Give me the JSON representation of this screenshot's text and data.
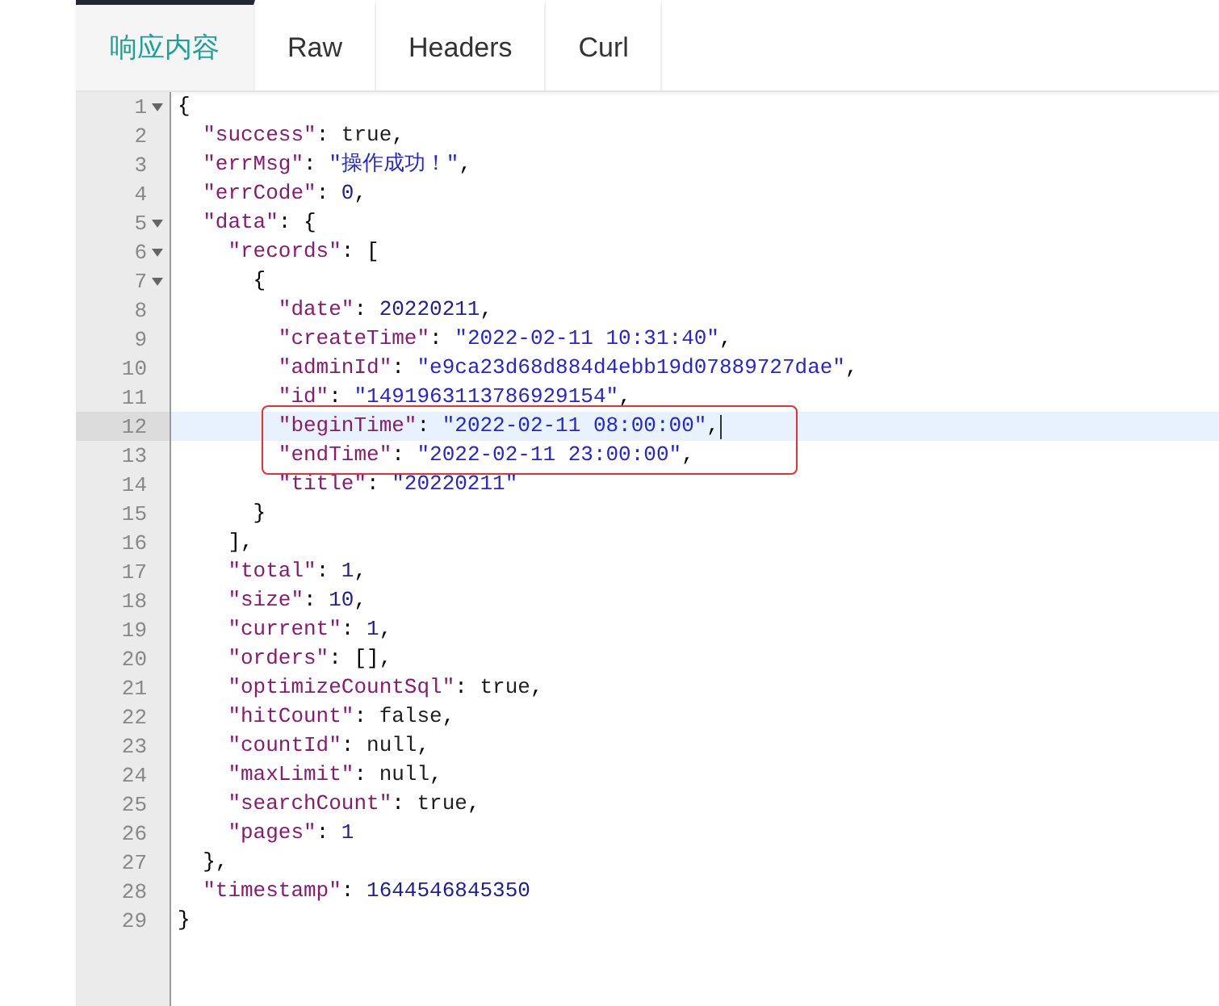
{
  "tabs": [
    {
      "label": "响应内容",
      "selected": true
    },
    {
      "label": "Raw",
      "selected": false
    },
    {
      "label": "Headers",
      "selected": false
    },
    {
      "label": "Curl",
      "selected": false
    }
  ],
  "editor": {
    "lines": [
      {
        "number": "1",
        "foldable": true,
        "tokens": [
          {
            "kind": "punct",
            "text": "{"
          }
        ],
        "children": [
          {
            "number": "2",
            "tokens": [
              {
                "kind": "key",
                "text": "\"success\""
              },
              {
                "kind": "punct",
                "text": ": "
              },
              {
                "kind": "literal",
                "text": "true"
              },
              {
                "kind": "punct",
                "text": ","
              }
            ]
          },
          {
            "number": "3",
            "tokens": [
              {
                "kind": "key",
                "text": "\"errMsg\""
              },
              {
                "kind": "punct",
                "text": ": "
              },
              {
                "kind": "string",
                "text": "\"操作成功！\""
              },
              {
                "kind": "punct",
                "text": ","
              }
            ]
          },
          {
            "number": "4",
            "tokens": [
              {
                "kind": "key",
                "text": "\"errCode\""
              },
              {
                "kind": "punct",
                "text": ": "
              },
              {
                "kind": "number",
                "text": "0"
              },
              {
                "kind": "punct",
                "text": ","
              }
            ]
          },
          {
            "number": "5",
            "foldable": true,
            "tokens": [
              {
                "kind": "key",
                "text": "\"data\""
              },
              {
                "kind": "punct",
                "text": ": {"
              }
            ],
            "children": [
              {
                "number": "6",
                "foldable": true,
                "tokens": [
                  {
                    "kind": "key",
                    "text": "\"records\""
                  },
                  {
                    "kind": "punct",
                    "text": ": ["
                  }
                ],
                "children": [
                  {
                    "number": "7",
                    "foldable": true,
                    "tokens": [
                      {
                        "kind": "punct",
                        "text": "{"
                      }
                    ],
                    "children": [
                      {
                        "number": "8",
                        "tokens": [
                          {
                            "kind": "key",
                            "text": "\"date\""
                          },
                          {
                            "kind": "punct",
                            "text": ": "
                          },
                          {
                            "kind": "number",
                            "text": "20220211"
                          },
                          {
                            "kind": "punct",
                            "text": ","
                          }
                        ]
                      },
                      {
                        "number": "9",
                        "tokens": [
                          {
                            "kind": "key",
                            "text": "\"createTime\""
                          },
                          {
                            "kind": "punct",
                            "text": ": "
                          },
                          {
                            "kind": "string",
                            "text": "\"2022-02-11 10:31:40\""
                          },
                          {
                            "kind": "punct",
                            "text": ","
                          }
                        ]
                      },
                      {
                        "number": "10",
                        "tokens": [
                          {
                            "kind": "key",
                            "text": "\"adminId\""
                          },
                          {
                            "kind": "punct",
                            "text": ": "
                          },
                          {
                            "kind": "string",
                            "text": "\"e9ca23d68d884d4ebb19d07889727dae\""
                          },
                          {
                            "kind": "punct",
                            "text": ","
                          }
                        ]
                      },
                      {
                        "number": "11",
                        "tokens": [
                          {
                            "kind": "key",
                            "text": "\"id\""
                          },
                          {
                            "kind": "punct",
                            "text": ": "
                          },
                          {
                            "kind": "string",
                            "text": "\"1491963113786929154\""
                          },
                          {
                            "kind": "punct",
                            "text": ","
                          }
                        ]
                      },
                      {
                        "number": "12",
                        "highlighted": true,
                        "boxed": true,
                        "cursor": true,
                        "tokens": [
                          {
                            "kind": "key",
                            "text": "\"beginTime\""
                          },
                          {
                            "kind": "punct",
                            "text": ": "
                          },
                          {
                            "kind": "string",
                            "text": "\"2022-02-11 08:00:00\""
                          },
                          {
                            "kind": "punct",
                            "text": ","
                          }
                        ]
                      },
                      {
                        "number": "13",
                        "boxed": true,
                        "tokens": [
                          {
                            "kind": "key",
                            "text": "\"endTime\""
                          },
                          {
                            "kind": "punct",
                            "text": ": "
                          },
                          {
                            "kind": "string",
                            "text": "\"2022-02-11 23:00:00\""
                          },
                          {
                            "kind": "punct",
                            "text": ","
                          }
                        ]
                      },
                      {
                        "number": "14",
                        "tokens": [
                          {
                            "kind": "key",
                            "text": "\"title\""
                          },
                          {
                            "kind": "punct",
                            "text": ": "
                          },
                          {
                            "kind": "string",
                            "text": "\"20220211\""
                          }
                        ]
                      }
                    ]
                  },
                  {
                    "number": "15",
                    "tokens": [
                      {
                        "kind": "punct",
                        "text": "}"
                      }
                    ]
                  }
                ]
              },
              {
                "number": "16",
                "tokens": [
                  {
                    "kind": "punct",
                    "text": "],"
                  }
                ]
              },
              {
                "number": "17",
                "tokens": [
                  {
                    "kind": "key",
                    "text": "\"total\""
                  },
                  {
                    "kind": "punct",
                    "text": ": "
                  },
                  {
                    "kind": "number",
                    "text": "1"
                  },
                  {
                    "kind": "punct",
                    "text": ","
                  }
                ]
              },
              {
                "number": "18",
                "tokens": [
                  {
                    "kind": "key",
                    "text": "\"size\""
                  },
                  {
                    "kind": "punct",
                    "text": ": "
                  },
                  {
                    "kind": "number",
                    "text": "10"
                  },
                  {
                    "kind": "punct",
                    "text": ","
                  }
                ]
              },
              {
                "number": "19",
                "tokens": [
                  {
                    "kind": "key",
                    "text": "\"current\""
                  },
                  {
                    "kind": "punct",
                    "text": ": "
                  },
                  {
                    "kind": "number",
                    "text": "1"
                  },
                  {
                    "kind": "punct",
                    "text": ","
                  }
                ]
              },
              {
                "number": "20",
                "tokens": [
                  {
                    "kind": "key",
                    "text": "\"orders\""
                  },
                  {
                    "kind": "punct",
                    "text": ": [],"
                  }
                ]
              },
              {
                "number": "21",
                "tokens": [
                  {
                    "kind": "key",
                    "text": "\"optimizeCountSql\""
                  },
                  {
                    "kind": "punct",
                    "text": ": "
                  },
                  {
                    "kind": "literal",
                    "text": "true"
                  },
                  {
                    "kind": "punct",
                    "text": ","
                  }
                ]
              },
              {
                "number": "22",
                "tokens": [
                  {
                    "kind": "key",
                    "text": "\"hitCount\""
                  },
                  {
                    "kind": "punct",
                    "text": ": "
                  },
                  {
                    "kind": "literal",
                    "text": "false"
                  },
                  {
                    "kind": "punct",
                    "text": ","
                  }
                ]
              },
              {
                "number": "23",
                "tokens": [
                  {
                    "kind": "key",
                    "text": "\"countId\""
                  },
                  {
                    "kind": "punct",
                    "text": ": "
                  },
                  {
                    "kind": "literal",
                    "text": "null"
                  },
                  {
                    "kind": "punct",
                    "text": ","
                  }
                ]
              },
              {
                "number": "24",
                "tokens": [
                  {
                    "kind": "key",
                    "text": "\"maxLimit\""
                  },
                  {
                    "kind": "punct",
                    "text": ": "
                  },
                  {
                    "kind": "literal",
                    "text": "null"
                  },
                  {
                    "kind": "punct",
                    "text": ","
                  }
                ]
              },
              {
                "number": "25",
                "tokens": [
                  {
                    "kind": "key",
                    "text": "\"searchCount\""
                  },
                  {
                    "kind": "punct",
                    "text": ": "
                  },
                  {
                    "kind": "literal",
                    "text": "true"
                  },
                  {
                    "kind": "punct",
                    "text": ","
                  }
                ]
              },
              {
                "number": "26",
                "tokens": [
                  {
                    "kind": "key",
                    "text": "\"pages\""
                  },
                  {
                    "kind": "punct",
                    "text": ": "
                  },
                  {
                    "kind": "number",
                    "text": "1"
                  }
                ]
              }
            ]
          },
          {
            "number": "27",
            "tokens": [
              {
                "kind": "punct",
                "text": "},"
              }
            ]
          },
          {
            "number": "28",
            "tokens": [
              {
                "kind": "key",
                "text": "\"timestamp\""
              },
              {
                "kind": "punct",
                "text": ": "
              },
              {
                "kind": "number",
                "text": "1644546845350"
              }
            ]
          }
        ]
      },
      {
        "number": "29",
        "tokens": [
          {
            "kind": "punct",
            "text": "}"
          }
        ]
      }
    ]
  }
}
